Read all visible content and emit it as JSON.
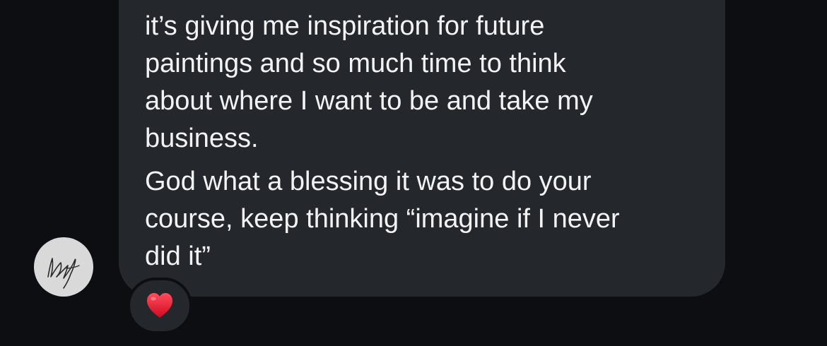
{
  "message": {
    "lines": [
      "it’s giving me inspiration for future",
      "paintings and so much time to think",
      "about where I want to be and take my",
      "business.",
      "God what a blessing it was to do your",
      "course, keep thinking “imagine if I never",
      "did it”"
    ]
  },
  "avatar": {
    "signature_text": "Kel"
  },
  "reaction": {
    "emoji_name": "red-heart",
    "color": "#e8152e"
  },
  "colors": {
    "background": "#0c0e11",
    "bubble": "#24272c",
    "text": "#f2f3f5"
  }
}
